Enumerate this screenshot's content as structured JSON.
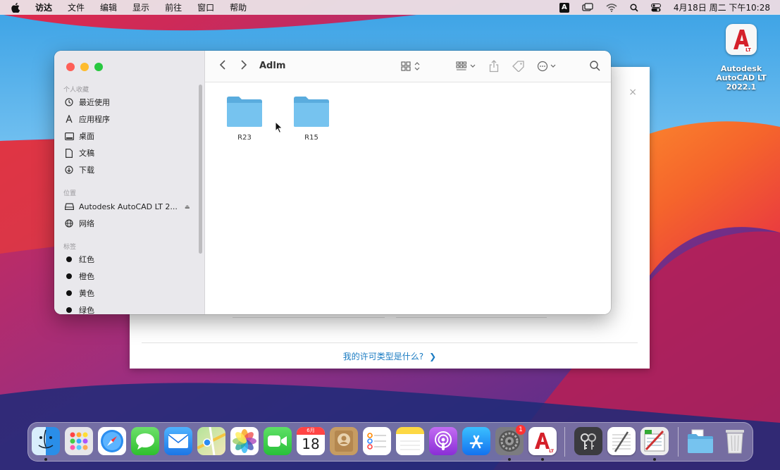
{
  "menubar": {
    "app": "访达",
    "items": [
      "文件",
      "编辑",
      "显示",
      "前往",
      "窗口",
      "帮助"
    ],
    "ime": "A",
    "clock": "4月18日 周二 下午10:28"
  },
  "desktop_icon": {
    "lt_mark": "LT",
    "line1": "Autodesk",
    "line2": "AutoCAD LT 2022.1"
  },
  "installer": {
    "close": "×",
    "license_link": "我的许可类型是什么?",
    "chevron": "❯"
  },
  "finder": {
    "title": "Adlm",
    "sidebar": {
      "favorites_title": "个人收藏",
      "favorites": [
        {
          "label": "最近使用",
          "icon": "clock-icon"
        },
        {
          "label": "应用程序",
          "icon": "apps-icon"
        },
        {
          "label": "桌面",
          "icon": "desktop-icon"
        },
        {
          "label": "文稿",
          "icon": "document-icon"
        },
        {
          "label": "下载",
          "icon": "download-icon"
        }
      ],
      "locations_title": "位置",
      "locations": [
        {
          "label": "Autodesk AutoCAD LT 2...",
          "icon": "drive-icon"
        },
        {
          "label": "网络",
          "icon": "globe-icon"
        }
      ],
      "tags_title": "标签",
      "tags": [
        {
          "label": "红色"
        },
        {
          "label": "橙色"
        },
        {
          "label": "黄色"
        },
        {
          "label": "绿色"
        }
      ]
    },
    "folders": [
      {
        "name": "R23"
      },
      {
        "name": "R15"
      }
    ]
  },
  "dock": {
    "apps": [
      {
        "name": "finder",
        "icon": "finder-icon",
        "running": true
      },
      {
        "name": "launchpad",
        "icon": "launchpad-icon"
      },
      {
        "name": "safari",
        "icon": "safari-icon"
      },
      {
        "name": "messages",
        "icon": "messages-icon"
      },
      {
        "name": "mail",
        "icon": "mail-icon"
      },
      {
        "name": "maps",
        "icon": "maps-icon"
      },
      {
        "name": "photos",
        "icon": "photos-icon"
      },
      {
        "name": "facetime",
        "icon": "facetime-icon"
      },
      {
        "name": "calendar",
        "icon": "calendar-icon",
        "month": "6月",
        "day": "18"
      },
      {
        "name": "contacts",
        "icon": "contacts-icon"
      },
      {
        "name": "reminders",
        "icon": "reminders-icon"
      },
      {
        "name": "notes",
        "icon": "notes-icon"
      },
      {
        "name": "podcasts",
        "icon": "podcasts-icon"
      },
      {
        "name": "app-store",
        "icon": "app-store-icon"
      },
      {
        "name": "system-preferences",
        "icon": "settings-icon",
        "badge": "1",
        "running": true
      },
      {
        "name": "autocad-lt",
        "icon": "autocad-icon",
        "lt_mark": "LT",
        "running": true
      },
      {
        "name": "keychain",
        "icon": "keychain-icon"
      },
      {
        "name": "textedit",
        "icon": "textedit-icon"
      },
      {
        "name": "script-editor",
        "icon": "script-editor-icon",
        "running": true
      },
      {
        "name": "downloads-stack",
        "icon": "folder-stack-icon"
      },
      {
        "name": "trash",
        "icon": "trash-icon"
      }
    ]
  }
}
